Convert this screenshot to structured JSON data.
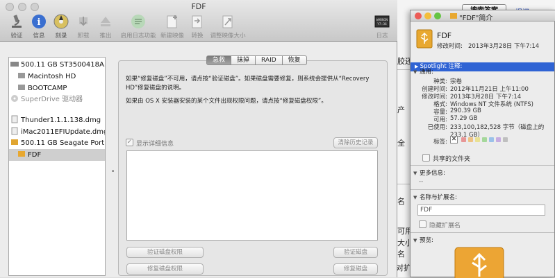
{
  "background": {
    "search_button": "搜索答案",
    "link": "提问",
    "snippets": [
      "胶还",
      "产",
      "全",
      "名",
      "可用",
      "大小",
      "名",
      "对扩"
    ]
  },
  "disk_utility": {
    "title": "FDF",
    "toolbar": [
      {
        "label": "验证",
        "icon": "microscope-icon",
        "disabled": false
      },
      {
        "label": "信息",
        "icon": "info-icon",
        "disabled": false
      },
      {
        "label": "刻录",
        "icon": "burn-disc-icon",
        "disabled": false
      },
      {
        "label": "卸载",
        "icon": "unmount-icon",
        "disabled": true
      },
      {
        "label": "推出",
        "icon": "eject-icon",
        "disabled": true
      },
      {
        "label": "启用日志功能",
        "icon": "journal-icon",
        "disabled": true
      },
      {
        "label": "新建映像",
        "icon": "new-image-icon",
        "disabled": true
      },
      {
        "label": "转换",
        "icon": "convert-icon",
        "disabled": true
      },
      {
        "label": "调整映像大小",
        "icon": "resize-image-icon",
        "disabled": true
      },
      {
        "label": "日志",
        "icon": "log-icon",
        "disabled": true
      }
    ],
    "log_badge": "WARNIN\nY7:36",
    "sidebar": [
      {
        "label": "500.11 GB ST3500418A…",
        "level": 0,
        "icon": "hard-drive-icon"
      },
      {
        "label": "Macintosh HD",
        "level": 1,
        "icon": "volume-icon"
      },
      {
        "label": "BOOTCAMP",
        "level": 1,
        "icon": "volume-icon"
      },
      {
        "label": "SuperDrive 驱动器",
        "level": 0,
        "icon": "optical-drive-icon",
        "disabled": true
      },
      {
        "label": "Thunder1.1.1.138.dmg",
        "level": 0,
        "icon": "dmg-icon"
      },
      {
        "label": "iMac2011EFIUpdate.dmg",
        "level": 0,
        "icon": "dmg-icon"
      },
      {
        "label": "500.11 GB Seagate Port…",
        "level": 0,
        "icon": "external-drive-icon"
      },
      {
        "label": "FDF",
        "level": 1,
        "icon": "usb-volume-icon",
        "selected": true
      }
    ],
    "tabs": [
      "急救",
      "抹掉",
      "RAID",
      "恢复"
    ],
    "active_tab": "急救",
    "para1": "如果“修复磁盘”不可用，请点按“验证磁盘”。如果磁盘需要修复，则系统会提供从“Recovery HD”修复磁盘的说明。",
    "para2": "如果由 OS X 安装器安装的某个文件出现权限问题，请点按“修复磁盘权限”。",
    "show_details": "显示详细信息",
    "clear_history": "清除历史记录",
    "verify_permissions": "验证磁盘权限",
    "verify_disk": "验证磁盘",
    "repair_permissions": "修复磁盘权限",
    "repair_disk": "修复磁盘"
  },
  "info_window": {
    "title": "\"FDF\"简介",
    "name": "FDF",
    "modified_label": "修改时间:",
    "modified_value": "2013年3月28日 下午7:14",
    "spotlight": "Spotlight 注释:",
    "general_header": "通用:",
    "rows": [
      {
        "label": "种类:",
        "value": "宗卷"
      },
      {
        "label": "创建时间:",
        "value": "2012年11月21日 上午11:00"
      },
      {
        "label": "修改时间:",
        "value": "2013年3月28日 下午7:14"
      },
      {
        "label": "格式:",
        "value": "Windows NT 文件系统 (NTFS)"
      },
      {
        "label": "容量:",
        "value": "290.39 GB"
      },
      {
        "label": "可用:",
        "value": "57.29 GB"
      },
      {
        "label": "已使用:",
        "value": "233,100,182,528 字节（磁盘上的"
      },
      {
        "label": "",
        "value": "233.1 GB）"
      }
    ],
    "tags_label": "标签:",
    "tag_colors": [
      "#e45050",
      "#f0a030",
      "#e8d84a",
      "#6cc85a",
      "#5a9ee8",
      "#a878d8",
      "#9a9a9a"
    ],
    "shared_folder": "共享的文件夹",
    "more_info_header": "更多信息:",
    "more_info_value": "--",
    "name_ext_header": "名称与扩展名:",
    "name_value": "FDF",
    "hide_ext": "隐藏扩展名",
    "preview_header": "预览:"
  }
}
